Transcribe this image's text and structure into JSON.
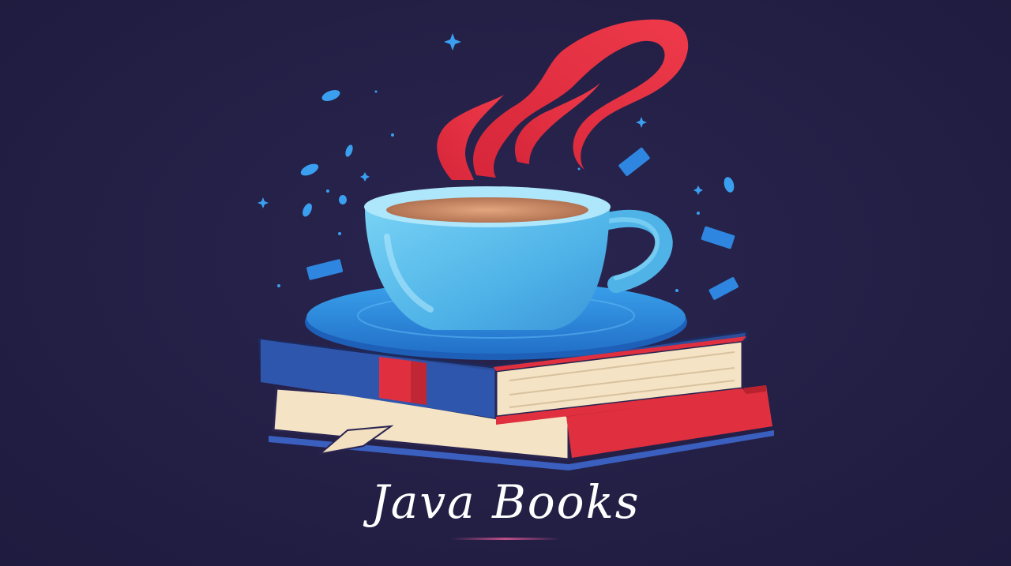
{
  "title": "Java Books",
  "colors": {
    "background": "#231f45",
    "steam": "#e02a3c",
    "cup": "#5bc0ec",
    "saucer": "#2f8fe0",
    "coffee": "#c98a63",
    "book_blue": "#2b4d9a",
    "book_red": "#e0303f",
    "pages": "#f4e3c4",
    "confetti": "#3b8fe8"
  },
  "icons": [
    "coffee-cup-icon",
    "book-stack-icon",
    "steam-icon",
    "sparkle-icon"
  ]
}
